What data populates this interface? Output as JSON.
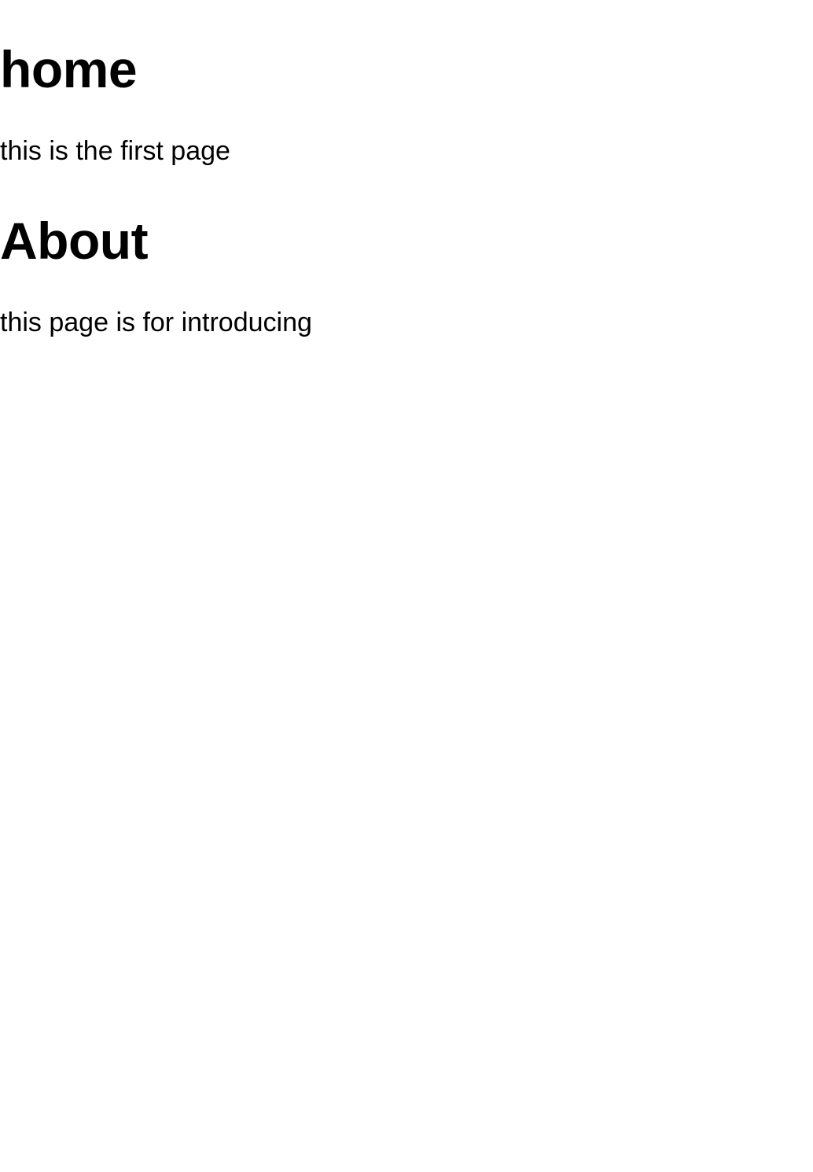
{
  "sections": [
    {
      "heading": "home",
      "text": "this is the first page"
    },
    {
      "heading": "About",
      "text": "this page is for introducing"
    }
  ]
}
